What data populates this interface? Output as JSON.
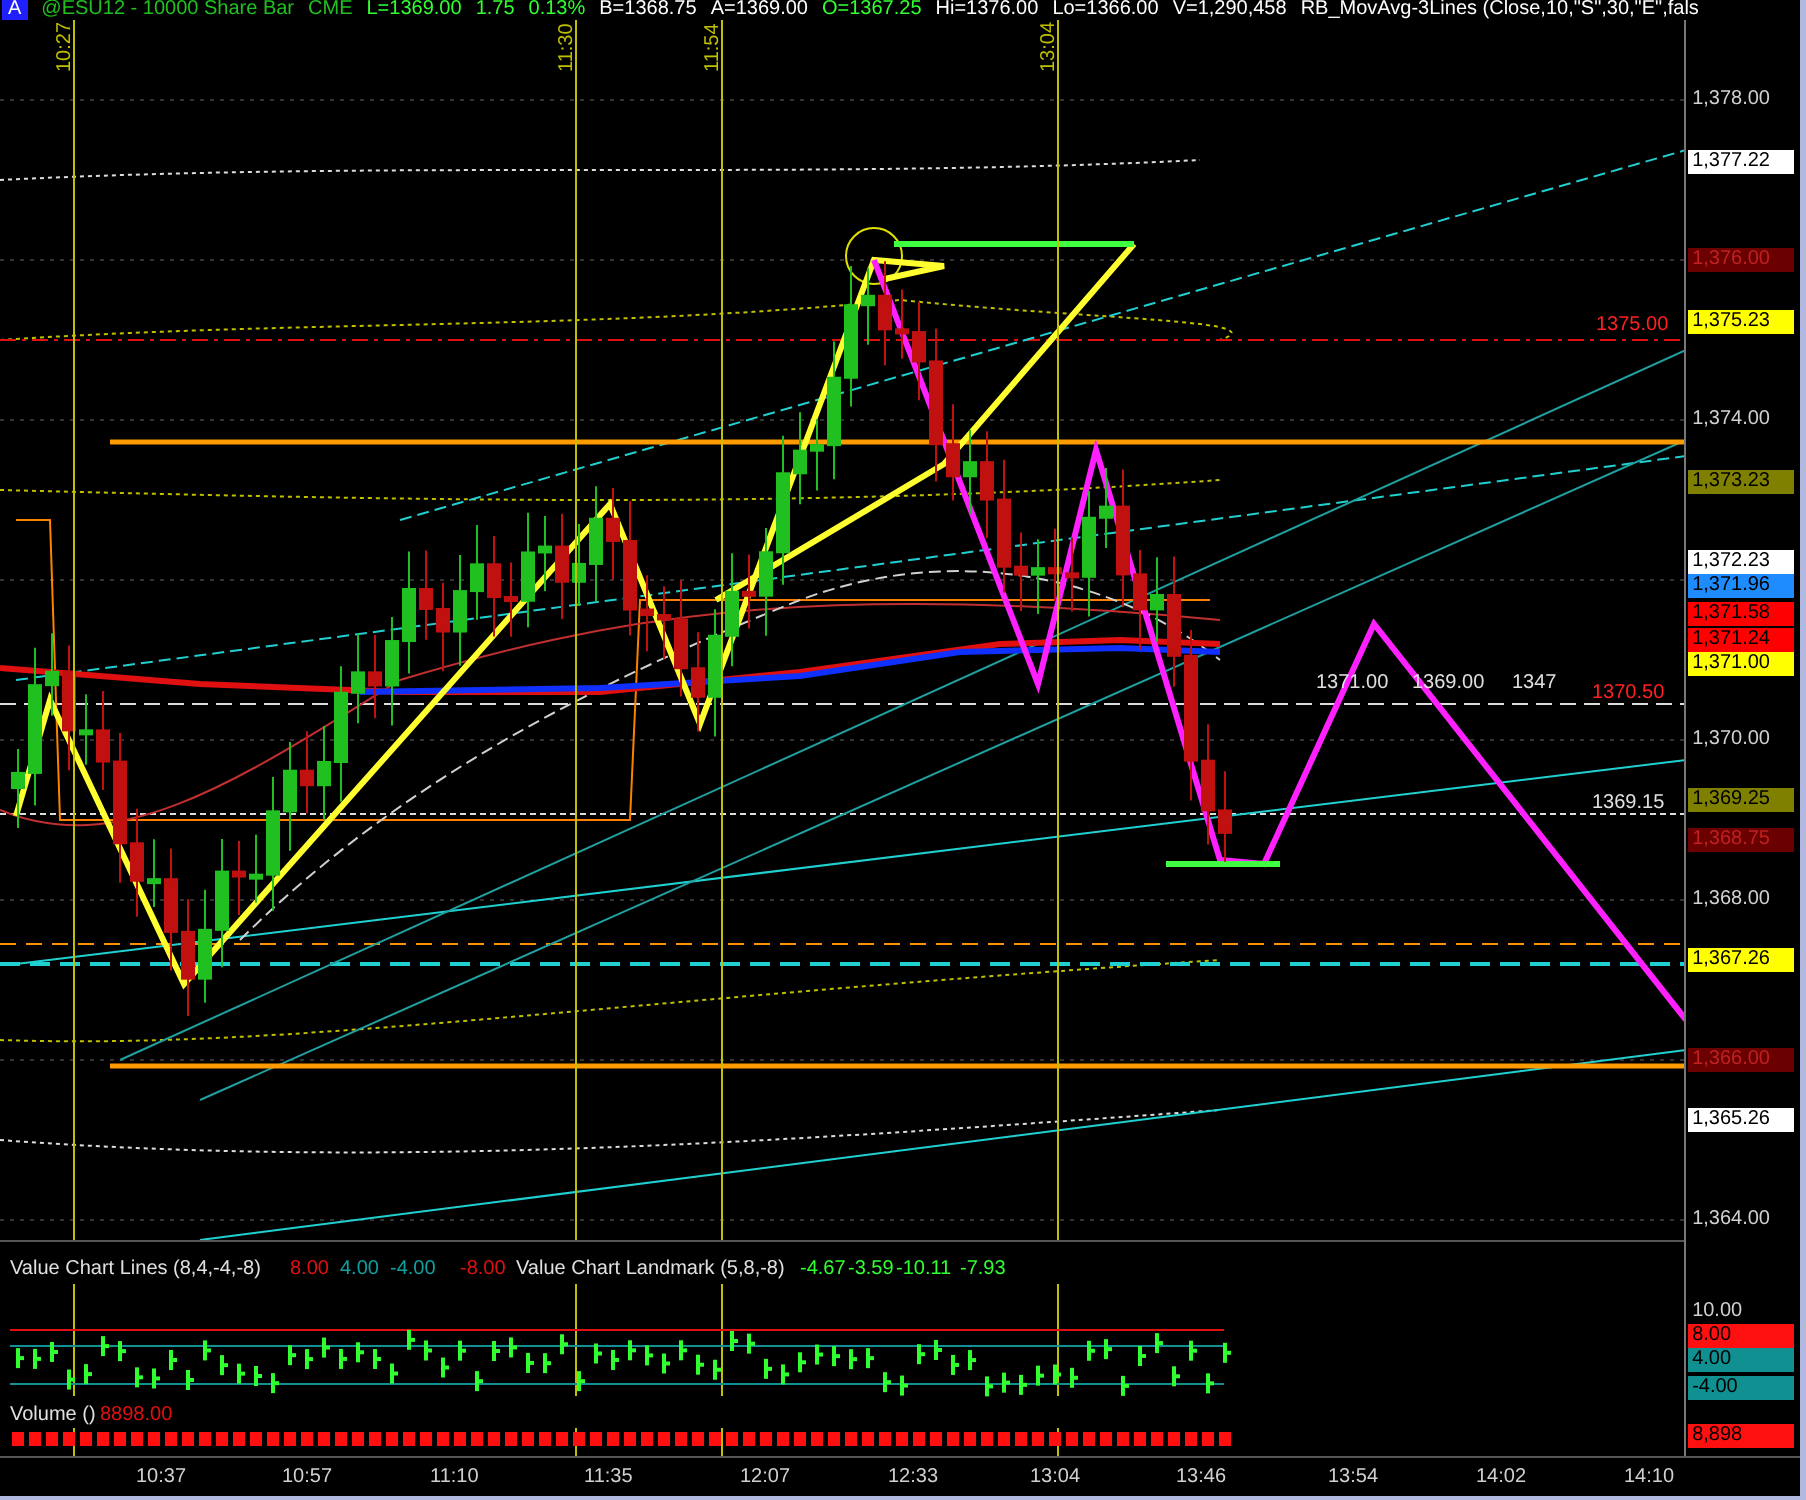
{
  "header": {
    "badge": "A",
    "items": [
      {
        "text": "@ESU12 - 10000 Share Bar",
        "color": "#20c020"
      },
      {
        "text": "CME",
        "color": "#20c020"
      },
      {
        "text": "L=1369.00",
        "color": "#30ff30"
      },
      {
        "text": "1.75",
        "color": "#30ff30"
      },
      {
        "text": "0.13%",
        "color": "#30ff30"
      },
      {
        "text": "B=1368.75",
        "color": "#ffffff"
      },
      {
        "text": "A=1369.00",
        "color": "#ffffff"
      },
      {
        "text": "O=1367.25",
        "color": "#30ff30"
      },
      {
        "text": "Hi=1376.00",
        "color": "#ffffff"
      },
      {
        "text": "Lo=1366.00",
        "color": "#ffffff"
      },
      {
        "text": "V=1,290,458",
        "color": "#ffffff"
      },
      {
        "text": "RB_MovAvg-3Lines (Close,10,\"S\",30,\"E\",fals",
        "color": "#ffffff"
      }
    ]
  },
  "time_markers": [
    "10:27",
    "11:30",
    "11:54",
    "13:04"
  ],
  "price_chart": {
    "labels": [
      {
        "text": "1375.00",
        "color": "#ff2020"
      },
      {
        "text": "1371.00",
        "color": "#e0e0e0"
      },
      {
        "text": "1369.00",
        "color": "#e0e0e0"
      },
      {
        "text": "1347",
        "color": "#e0e0e0"
      },
      {
        "text": "1370.50",
        "color": "#ff2020"
      },
      {
        "text": "1369.15",
        "color": "#e0e0e0"
      }
    ]
  },
  "price_axis": {
    "ticks": [
      "1,378.00",
      "1,374.00",
      "1,370.00",
      "1,368.00",
      "1,364.00"
    ],
    "tags": [
      {
        "text": "1,377.22",
        "color": "#ffffff"
      },
      {
        "text": "1,376.00",
        "color": "#6a0000"
      },
      {
        "text": "1,375.23",
        "color": "#ffff00"
      },
      {
        "text": "1,373.23",
        "color": "#808000"
      },
      {
        "text": "1,372.23",
        "color": "#ffffff"
      },
      {
        "text": "1,371.96",
        "color": "#1e8cff"
      },
      {
        "text": "1,371.58",
        "color": "#ff0000"
      },
      {
        "text": "1,371.24",
        "color": "#ff0000"
      },
      {
        "text": "1,371.00",
        "color": "#ffff00"
      },
      {
        "text": "1,369.25",
        "color": "#808000"
      },
      {
        "text": "1,368.75",
        "color": "#6a0000"
      },
      {
        "text": "1,367.26",
        "color": "#ffff00"
      },
      {
        "text": "1,366.00",
        "color": "#6a0000"
      },
      {
        "text": "1,365.26",
        "color": "#ffffff"
      }
    ]
  },
  "value_chart": {
    "title": "Value Chart Lines (8,4,-4,-8)",
    "readings": [
      {
        "text": "8.00",
        "color": "#e01010"
      },
      {
        "text": "4.00",
        "color": "#10a0a0"
      },
      {
        "text": "-4.00",
        "color": "#10a0a0"
      },
      {
        "text": "-8.00",
        "color": "#e01010"
      }
    ],
    "landmark_title": "Value Chart Landmark (5,8,-8)",
    "landmark_readings": [
      "-4.67",
      "-3.59",
      "-10.11",
      "-7.93"
    ],
    "axis_tick": "10.00",
    "axis_tags": [
      {
        "text": "8.00",
        "color": "#ff1010"
      },
      {
        "text": "4.00",
        "color": "#109090"
      },
      {
        "text": "-4.00",
        "color": "#109090"
      }
    ]
  },
  "volume": {
    "title": "Volume ()",
    "reading": "8898.00",
    "axis_tag": "8,898"
  },
  "time_axis": [
    "10:37",
    "10:57",
    "11:10",
    "11:35",
    "12:07",
    "12:33",
    "13:04",
    "13:46",
    "13:54",
    "14:02",
    "14:10"
  ]
}
